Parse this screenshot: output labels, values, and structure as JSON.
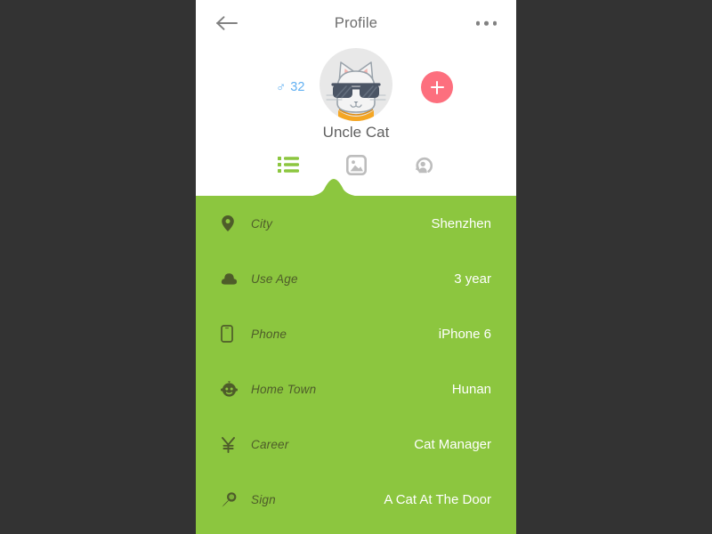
{
  "theme": {
    "page_background": "#333333",
    "phone_background": "#ffffff",
    "accent_green": "#8cc63f",
    "accent_pink": "#fd6f7e",
    "gender_blue": "#61b0f2",
    "label_olive": "#4e5c2a",
    "value_white": "#ffffff",
    "nav_gray": "#6d6d6d"
  },
  "navbar": {
    "title": "Profile",
    "back_icon": "arrow-left-icon",
    "more_icon": "more-horizontal-icon"
  },
  "profile": {
    "name": "Uncle Cat",
    "gender_symbol": "♂",
    "age": "32",
    "avatar_icon": "cat-avatar",
    "add_button_label": "+"
  },
  "tabs": [
    {
      "name": "tab-info",
      "icon": "list-icon",
      "active": true
    },
    {
      "name": "tab-photos",
      "icon": "image-icon",
      "active": false
    },
    {
      "name": "tab-activity",
      "icon": "person-refresh-icon",
      "active": false
    }
  ],
  "info_rows": [
    {
      "icon": "location-pin-icon",
      "label": "City",
      "value": "Shenzhen"
    },
    {
      "icon": "cloud-icon",
      "label": "Use Age",
      "value": "3 year"
    },
    {
      "icon": "phone-icon",
      "label": "Phone",
      "value": "iPhone 6"
    },
    {
      "icon": "baby-face-icon",
      "label": "Home Town",
      "value": "Hunan"
    },
    {
      "icon": "yen-icon",
      "label": "Career",
      "value": "Cat Manager"
    },
    {
      "icon": "microphone-icon",
      "label": "Sign",
      "value": "A Cat At The Door"
    }
  ]
}
